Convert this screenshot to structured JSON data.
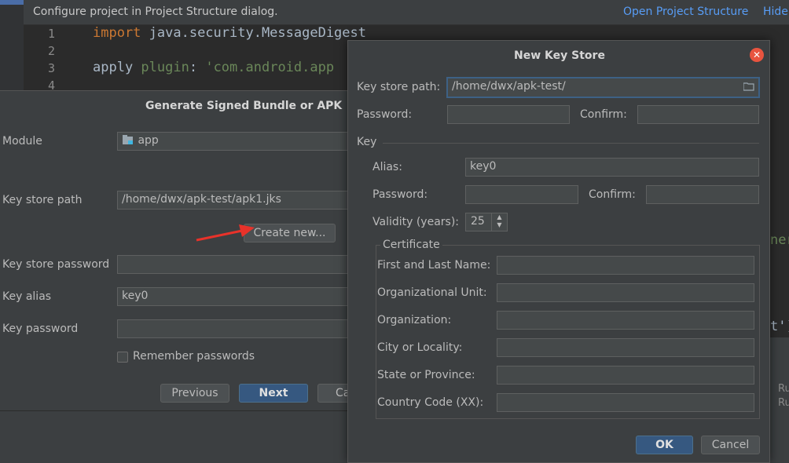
{
  "ide": {
    "notification": {
      "message": "Configure project in Project Structure dialog.",
      "link_open": "Open Project Structure",
      "link_hide": "Hide"
    },
    "gutter": [
      "1",
      "2",
      "3",
      "4"
    ],
    "code": {
      "line1_kw": "import",
      "line1_rest": " java.security.MessageDigest",
      "line3_plain": "apply ",
      "line3_key": "plugin",
      "line3_colon": ": ",
      "line3_str": "'com.android.app"
    },
    "frag_ner": "ner",
    "frag_t": "t')",
    "frag_ru1": "Ru",
    "frag_ru2": "Ru"
  },
  "generate_dialog": {
    "title": "Generate Signed Bundle or APK",
    "module_label": "Module",
    "module_value": "app",
    "key_store_path_label": "Key store path",
    "key_store_path_value": "/home/dwx/apk-test/apk1.jks",
    "create_new_label": "Create new...",
    "key_store_password_label": "Key store password",
    "key_alias_label": "Key alias",
    "key_alias_value": "key0",
    "key_password_label": "Key password",
    "remember_label": "Remember passwords",
    "previous_label": "Previous",
    "next_label": "Next",
    "cancel_label": "Ca"
  },
  "new_key_store": {
    "title": "New Key Store",
    "path_label": "Key store path:",
    "path_value": "/home/dwx/apk-test/",
    "password_label": "Password:",
    "confirm_label": "Confirm:",
    "key_section": "Key",
    "alias_label": "Alias:",
    "alias_value": "key0",
    "key_password_label": "Password:",
    "key_confirm_label": "Confirm:",
    "validity_label": "Validity (years):",
    "validity_value": "25",
    "certificate_section": "Certificate",
    "first_last_label": "First and Last Name:",
    "org_unit_label": "Organizational Unit:",
    "org_label": "Organization:",
    "city_label": "City or Locality:",
    "state_label": "State or Province:",
    "country_label": "Country Code (XX):",
    "ok_label": "OK",
    "cancel_label": "Cancel"
  },
  "colors": {
    "accent": "#589df6",
    "primary_button": "#365880",
    "close_button": "#e8543f",
    "arrow": "#e8322a"
  }
}
